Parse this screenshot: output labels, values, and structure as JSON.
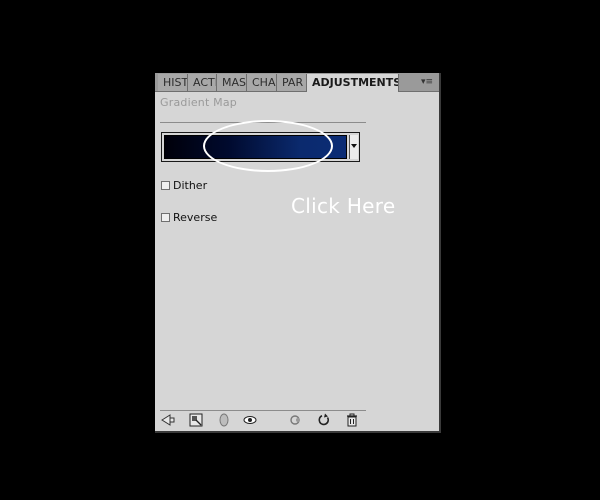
{
  "tabs": [
    {
      "label": "HIST"
    },
    {
      "label": "ACTI"
    },
    {
      "label": "MAS"
    },
    {
      "label": "CHA"
    },
    {
      "label": "PAR"
    },
    {
      "label": "ADJUSTMENTS"
    }
  ],
  "panel": {
    "title": "Gradient Map",
    "gradient_colors": [
      "#00000a",
      "#0b2c75"
    ],
    "options": {
      "dither_label": "Dither",
      "reverse_label": "Reverse"
    }
  },
  "annotation": {
    "text": "Click Here",
    "color": "#ffffff"
  },
  "icons": {
    "tab_menu": "panel-menu-icon",
    "back": "back-arrow-icon",
    "expand": "expand-view-icon",
    "clip": "clip-to-layer-icon",
    "visibility": "eye-icon",
    "previous_state": "view-previous-icon",
    "reset": "reset-icon",
    "trash": "trash-icon"
  }
}
